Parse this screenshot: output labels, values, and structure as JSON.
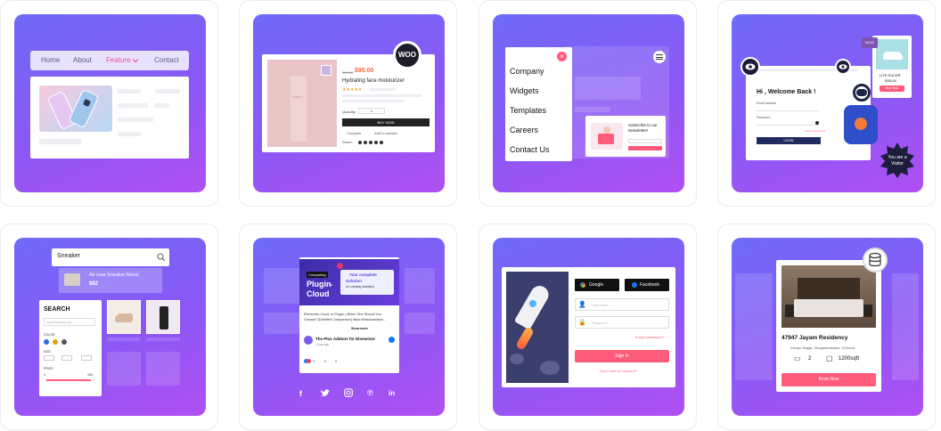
{
  "cards": {
    "menu": {
      "items": [
        "Home",
        "About",
        "Feature",
        "Contact"
      ]
    },
    "product": {
      "badge": "WOO",
      "old_price": "$95.00",
      "price": "$95.00",
      "title": "Hydrating face moisturizer",
      "qty_label": "Quantity",
      "qty": "1",
      "buy_label": "BUY NOW",
      "compare": "Compare",
      "wishlist": "Add to wishlist",
      "share": "Share:",
      "tube_text": "NOBOX"
    },
    "sidebar": {
      "items": [
        "Company",
        "Widgets",
        "Templates",
        "Careers",
        "Contact Us"
      ],
      "subscribe_title": "Subscribe to our Newsletter!"
    },
    "login": {
      "title": "Hi , Welcome Back !",
      "email_label": "Email address",
      "password_label": "Password",
      "forgot": "Forgot Password",
      "login_btn": "LOGIN",
      "shoe_title": "LITE RACER",
      "shoe_price": "$300.00",
      "buy": "Buy Now",
      "visitor": "You are a Visitor",
      "woo": "WOO"
    },
    "search": {
      "query": "Sneaker",
      "result_title": "Air max Sneaker Mens",
      "result_price": "$62",
      "panel_title": "SEARCH",
      "panel_placeholder": "Search Products here",
      "color_label": "COLOR",
      "size_label": "SIZE",
      "price_label": "PRICE",
      "price_min": "0",
      "price_max": "100"
    },
    "social": {
      "tag": "Comparing",
      "headline_a": "Plugin",
      "headline_b": "vs",
      "headline_c": "Cloud",
      "banner_a": "Your complete",
      "banner_b": "Solution",
      "banner_c": "for creating websites",
      "body": "Elementor Cloud vs Plugin | Which One Should You Choose? [Detailed Comparison] https://theplusaddon...",
      "show_more": "Show more",
      "author": "The Plus Addons for Elementor",
      "date": "1 day ago",
      "reactions": "3",
      "comments": "0",
      "shares": "0"
    },
    "signup": {
      "google": "Google",
      "facebook": "Facebook",
      "email_ph": "Username",
      "password_ph": "Password",
      "forgot": "Forgot password?",
      "signin": "Sign In",
      "no_account": "Don't have an account?"
    },
    "listing": {
      "title": "47947 Jayam Residency",
      "address": "Elango Nagar, Virugambakkam, Chennai",
      "beds": "2",
      "area": "1200sqft",
      "book": "Book Now"
    }
  },
  "colors": {
    "accent": "#ff5b7b",
    "grad_top": "#6f6af8",
    "grad_bottom": "#b14ff2"
  }
}
